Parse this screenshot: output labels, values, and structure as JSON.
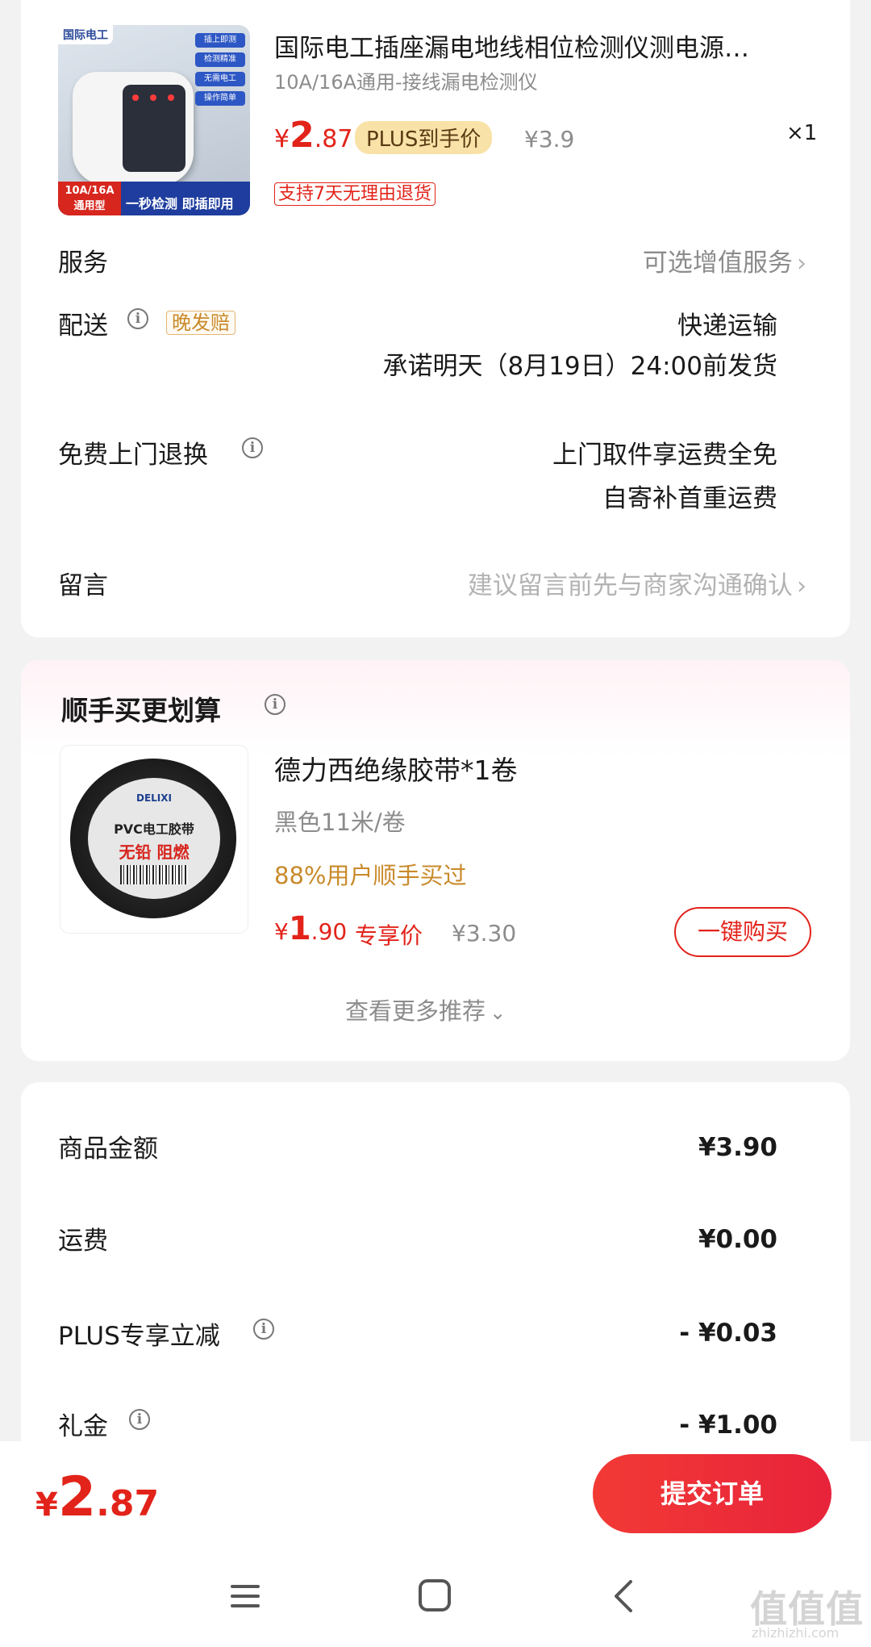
{
  "product": {
    "image_brand": "国际电工",
    "image_features": [
      "插上即测",
      "检测精准",
      "无需电工",
      "操作简单"
    ],
    "image_bottom_left": "10A/16A 通用型",
    "image_bottom_right": "一秒检测 即插即用",
    "title": "国际电工插座漏电地线相位检测仪测电源…",
    "spec": "10A/16A通用-接线漏电检测仪",
    "price_symbol": "¥",
    "price_int": "2",
    "price_dec": ".87",
    "plus_tag": "PLUS到手价",
    "orig_price": "¥3.9",
    "quantity": "×1",
    "return_tag": "支持7天无理由退货"
  },
  "service": {
    "label": "服务",
    "value": "可选增值服务"
  },
  "delivery": {
    "label": "配送",
    "late_tag": "晚发赔",
    "method": "快递运输",
    "promise": "承诺明天（8月19日）24:00前发货"
  },
  "door_return": {
    "label": "免费上门退换",
    "line1": "上门取件享运费全免",
    "line2": "自寄补首重运费"
  },
  "message": {
    "label": "留言",
    "placeholder": "建议留言前先与商家沟通确认"
  },
  "upsell": {
    "title": "顺手买更划算",
    "item": {
      "image_brand": "DELIXI",
      "image_name": "PVC电工胶带",
      "image_tags": "无铅 阻燃",
      "name": "德力西绝缘胶带*1卷",
      "spec": "黑色11米/卷",
      "bought": "88%用户顺手买过",
      "price_symbol": "¥",
      "price_int": "1",
      "price_dec": ".90",
      "price_label": "专享价",
      "orig_price": "¥3.30",
      "buy_button": "一键购买"
    },
    "more": "查看更多推荐"
  },
  "summary": {
    "rows": [
      {
        "label": "商品金额",
        "value": "¥3.90"
      },
      {
        "label": "运费",
        "value": "¥0.00"
      },
      {
        "label": "PLUS专享立减",
        "value": "- ¥0.03"
      },
      {
        "label": "礼金",
        "value": "- ¥1.00"
      }
    ]
  },
  "footer": {
    "total_symbol": "¥",
    "total_int": "2",
    "total_dec": ".87",
    "submit": "提交订单"
  },
  "watermark": {
    "main": "值值值",
    "sub": "zhizhizhi.com"
  },
  "colors": {
    "accent": "#e2231a",
    "plus_tag_bg": "#f8e2a8",
    "late_tag": "#c98a2a"
  },
  "icons": [
    "info-icon",
    "chevron-right-icon",
    "chevron-down-icon",
    "menu-icon",
    "home-icon",
    "back-icon"
  ]
}
